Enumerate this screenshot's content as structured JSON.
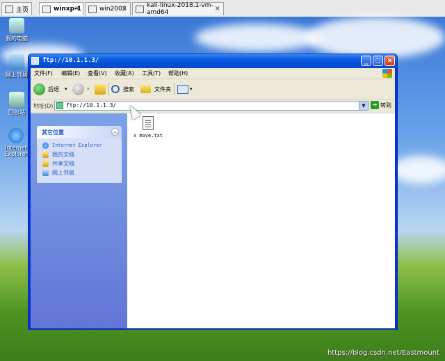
{
  "vm_tabs": [
    {
      "label": "主页",
      "active": false
    },
    {
      "label": "winxp-1",
      "active": true
    },
    {
      "label": "win2003",
      "active": false
    },
    {
      "label": "kali-linux-2018.1-vm-amd64",
      "active": false
    }
  ],
  "desktop_icons": [
    {
      "label": "我的电脑",
      "icon": "computer-icon"
    },
    {
      "label": "网上邻居",
      "icon": "network-icon"
    },
    {
      "label": "回收站",
      "icon": "recycle-bin-icon"
    },
    {
      "label": "Internet Explorer",
      "icon": "ie-icon"
    }
  ],
  "window": {
    "title": "ftp://10.1.1.3/",
    "menu": [
      "文件(F)",
      "编辑(E)",
      "查看(V)",
      "收藏(A)",
      "工具(T)",
      "帮助(H)"
    ],
    "toolbar": {
      "back": "后退",
      "search": "搜索",
      "folders": "文件夹"
    },
    "address": {
      "label": "地址(D)",
      "value": "ftp://10.1.1.3/",
      "go": "转到"
    },
    "other_places": {
      "title": "其它位置",
      "items": [
        "Internet Explorer",
        "我的文档",
        "共享文档",
        "网上邻居"
      ]
    },
    "files": [
      {
        "name": "x move.txt"
      }
    ]
  },
  "watermark": "https://blog.csdn.net/Eastmount",
  "colors": {
    "titlebar": "#0a5ae0",
    "task_link": "#215dc6",
    "left_pane": "#6f8fe0"
  }
}
